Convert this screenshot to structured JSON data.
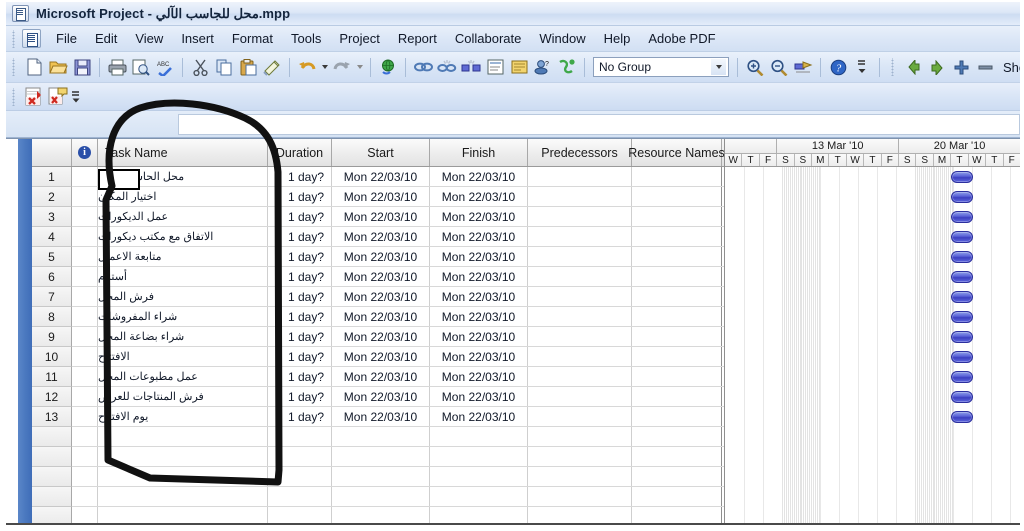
{
  "window": {
    "title": "Microsoft Project - محل للجاسب الآلي.mpp",
    "app_icon": "project-app-icon"
  },
  "menubar": {
    "control_icon": "document-menu-icon",
    "items": [
      {
        "label": "File"
      },
      {
        "label": "Edit"
      },
      {
        "label": "View"
      },
      {
        "label": "Insert"
      },
      {
        "label": "Format"
      },
      {
        "label": "Tools"
      },
      {
        "label": "Project"
      },
      {
        "label": "Report"
      },
      {
        "label": "Collaborate"
      },
      {
        "label": "Window"
      },
      {
        "label": "Help"
      },
      {
        "label": "Adobe PDF"
      }
    ]
  },
  "toolbar": {
    "buttons": [
      {
        "name": "new-icon"
      },
      {
        "name": "open-icon"
      },
      {
        "name": "save-icon"
      },
      {
        "name": "print-icon"
      },
      {
        "name": "print-preview-icon"
      },
      {
        "name": "spelling-icon"
      },
      {
        "name": "cut-icon"
      },
      {
        "name": "copy-icon"
      },
      {
        "name": "paste-icon"
      },
      {
        "name": "format-painter-icon"
      },
      {
        "name": "undo-icon"
      },
      {
        "name": "redo-icon"
      },
      {
        "name": "hyperlink-globe-icon"
      },
      {
        "name": "link-tasks-icon"
      },
      {
        "name": "unlink-tasks-icon"
      },
      {
        "name": "split-task-icon"
      },
      {
        "name": "task-information-icon"
      },
      {
        "name": "notes-icon"
      },
      {
        "name": "assign-resources-icon"
      },
      {
        "name": "publish-icon"
      },
      {
        "name": "zoom-in-icon"
      },
      {
        "name": "zoom-out-icon"
      },
      {
        "name": "goto-selected-task-icon"
      },
      {
        "name": "help-icon"
      },
      {
        "name": "toolbar-overflow-icon"
      }
    ],
    "group_combo": {
      "value": "No Group",
      "arrow_icon": "chevron-down-icon"
    },
    "outdent_icon": "outdent-arrow-icon",
    "indent_icon": "indent-arrow-icon",
    "show_subtasks_icon": "show-subtasks-plus-icon",
    "hide_subtasks_icon": "hide-subtasks-minus-icon",
    "show_label": "Show"
  },
  "toolbar2": {
    "buttons": [
      {
        "name": "convert-to-adobe-pdf-icon"
      },
      {
        "name": "convert-to-adobe-pdf-and-email-icon"
      }
    ],
    "overflow_icon": "toolbar-overflow-icon"
  },
  "entry_bar": {
    "value": "",
    "placeholder": ""
  },
  "grid": {
    "columns": [
      {
        "key": "indicator",
        "label": "",
        "icon": "information-indicator-icon"
      },
      {
        "key": "name",
        "label": "Task Name"
      },
      {
        "key": "duration",
        "label": "Duration"
      },
      {
        "key": "start",
        "label": "Start"
      },
      {
        "key": "finish",
        "label": "Finish"
      },
      {
        "key": "predecessors",
        "label": "Predecessors"
      },
      {
        "key": "resources",
        "label": "Resource Names"
      }
    ],
    "rows": [
      {
        "num": "1",
        "name": "محل الحاسب الالي",
        "duration": "1 day?",
        "start": "Mon 22/03/10",
        "finish": "Mon 22/03/10",
        "predecessors": "",
        "resources": ""
      },
      {
        "num": "2",
        "name": "اختيار المكان",
        "duration": "1 day?",
        "start": "Mon 22/03/10",
        "finish": "Mon 22/03/10",
        "predecessors": "",
        "resources": ""
      },
      {
        "num": "3",
        "name": "عمل الديكورات",
        "duration": "1 day?",
        "start": "Mon 22/03/10",
        "finish": "Mon 22/03/10",
        "predecessors": "",
        "resources": ""
      },
      {
        "num": "4",
        "name": "الاتفاق مع مكتب ديكورات",
        "duration": "1 day?",
        "start": "Mon 22/03/10",
        "finish": "Mon 22/03/10",
        "predecessors": "",
        "resources": ""
      },
      {
        "num": "5",
        "name": "متابعة الاعمال",
        "duration": "1 day?",
        "start": "Mon 22/03/10",
        "finish": "Mon 22/03/10",
        "predecessors": "",
        "resources": ""
      },
      {
        "num": "6",
        "name": "أستلام",
        "duration": "1 day?",
        "start": "Mon 22/03/10",
        "finish": "Mon 22/03/10",
        "predecessors": "",
        "resources": ""
      },
      {
        "num": "7",
        "name": "فرش المحل",
        "duration": "1 day?",
        "start": "Mon 22/03/10",
        "finish": "Mon 22/03/10",
        "predecessors": "",
        "resources": ""
      },
      {
        "num": "8",
        "name": "شراء المفروشات",
        "duration": "1 day?",
        "start": "Mon 22/03/10",
        "finish": "Mon 22/03/10",
        "predecessors": "",
        "resources": ""
      },
      {
        "num": "9",
        "name": "شراء بضاعة المحل",
        "duration": "1 day?",
        "start": "Mon 22/03/10",
        "finish": "Mon 22/03/10",
        "predecessors": "",
        "resources": ""
      },
      {
        "num": "10",
        "name": "الافتتاح",
        "duration": "1 day?",
        "start": "Mon 22/03/10",
        "finish": "Mon 22/03/10",
        "predecessors": "",
        "resources": ""
      },
      {
        "num": "11",
        "name": "عمل مطبوعات المحل",
        "duration": "1 day?",
        "start": "Mon 22/03/10",
        "finish": "Mon 22/03/10",
        "predecessors": "",
        "resources": ""
      },
      {
        "num": "12",
        "name": "فرش المنتاجات للعرض",
        "duration": "1 day?",
        "start": "Mon 22/03/10",
        "finish": "Mon 22/03/10",
        "predecessors": "",
        "resources": ""
      },
      {
        "num": "13",
        "name": "يوم الافتتاح",
        "duration": "1 day?",
        "start": "Mon 22/03/10",
        "finish": "Mon 22/03/10",
        "predecessors": "",
        "resources": ""
      }
    ],
    "empty_row_count": 5
  },
  "timescale": {
    "weeks": [
      {
        "label": "13 Mar '10"
      },
      {
        "label": "20 Mar '10"
      }
    ],
    "days": [
      "W",
      "T",
      "F",
      "S",
      "S",
      "M",
      "T",
      "W",
      "T",
      "F",
      "S",
      "S",
      "M",
      "T",
      "W",
      "T",
      "F"
    ],
    "nonworking_day_indices": [
      3,
      4,
      10,
      11
    ]
  },
  "gantt": {
    "bar_count": 13,
    "bar_color": "#4a4fd0",
    "bar_day_index": 12
  },
  "annotation": {
    "type": "hand-drawn-ellipse-highlight",
    "target": "Task Name column",
    "color": "#000000"
  }
}
